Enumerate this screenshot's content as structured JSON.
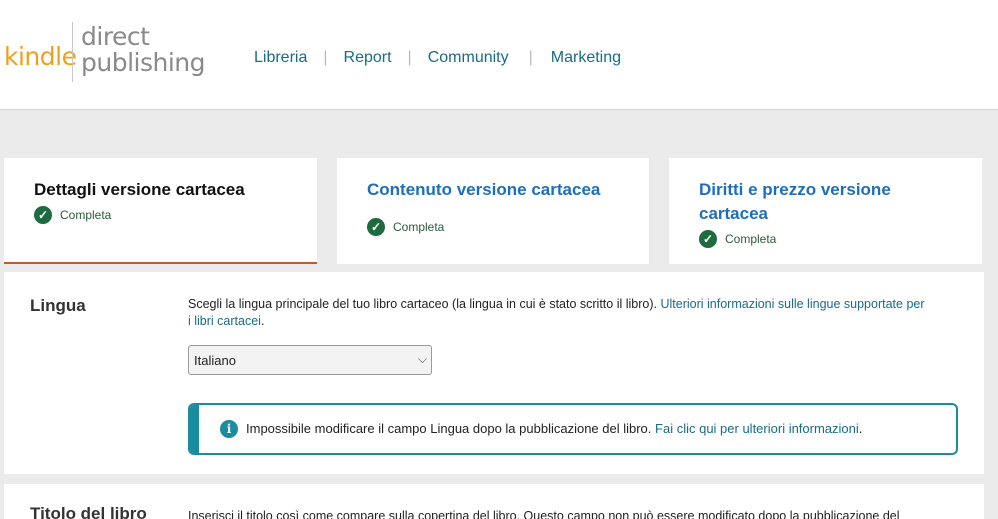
{
  "logo": {
    "kindle": "kindle",
    "line1": "direct",
    "line2": "publishing"
  },
  "nav": {
    "items": [
      "Libreria",
      "Report",
      "Community",
      "Marketing"
    ],
    "separator": "|"
  },
  "tabs": [
    {
      "title": "Dettagli versione cartacea",
      "status": "Completa"
    },
    {
      "title": "Contenuto versione cartacea",
      "status": "Completa"
    },
    {
      "title": "Diritti e prezzo versione cartacea",
      "status": "Completa"
    }
  ],
  "language": {
    "label": "Lingua",
    "description": "Scegli la lingua principale del tuo libro cartaceo (la lingua in cui è stato scritto il libro).",
    "link": "Ulteriori informazioni sulle lingue supportate per i libri cartacei",
    "link_suffix": ".",
    "selected": "Italiano",
    "alert_text": "Impossibile modificare il campo Lingua dopo la pubblicazione del libro.",
    "alert_link": "Fai clic qui per ulteriori informazioni",
    "alert_suffix": "."
  },
  "title_section": {
    "label": "Titolo del libro",
    "description": "Inserisci il titolo così come compare sulla copertina del libro. Questo campo non può essere modificato dopo la pubblicazione del"
  }
}
